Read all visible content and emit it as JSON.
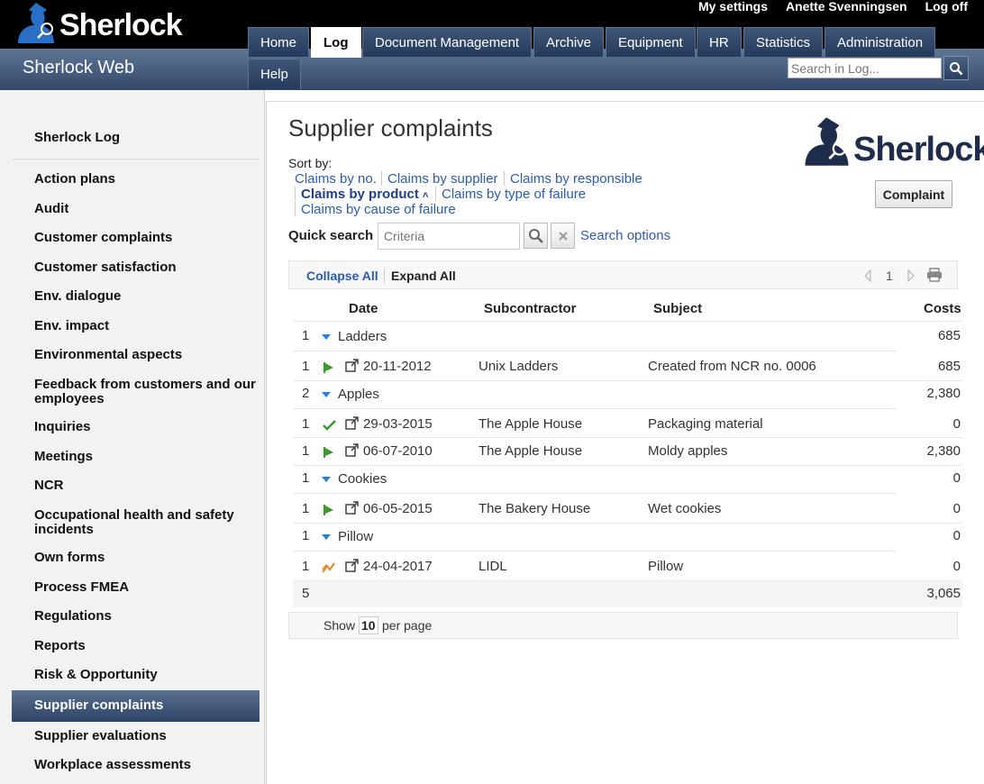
{
  "header": {
    "logo_text": "Sherlock",
    "site_title": "Sherlock Web",
    "top_links": [
      "My settings",
      "Anette Svenningsen",
      "Log off"
    ],
    "tabs": [
      "Home",
      "Log",
      "Document Management",
      "Archive",
      "Equipment",
      "HR",
      "Statistics",
      "Administration",
      "Help"
    ],
    "active_tab": "Log",
    "search_placeholder": "Search in Log..."
  },
  "sidebar": {
    "title": "Sherlock Log",
    "items": [
      "Action plans",
      "Audit",
      "Customer complaints",
      "Customer satisfaction",
      "Env. dialogue",
      "Env. impact",
      "Environmental aspects",
      "Feedback from customers and our employees",
      "Inquiries",
      "Meetings",
      "NCR",
      "Occupational health and safety incidents",
      "Own forms",
      "Process FMEA",
      "Regulations",
      "Reports",
      "Risk & Opportunity",
      "Supplier complaints",
      "Supplier evaluations",
      "Workplace assessments"
    ],
    "active_item": "Supplier complaints"
  },
  "main": {
    "title": "Supplier complaints",
    "logo_text": "Sherlock",
    "complaint_button": "Complaint",
    "sort_label": "Sort by:",
    "sort_options": [
      "Claims by no.",
      "Claims by supplier",
      "Claims by responsible",
      "Claims by product",
      "Claims by type of failure",
      "Claims by cause of failure"
    ],
    "active_sort": "Claims by product",
    "quick_search_label": "Quick search",
    "quick_search_placeholder": "Criteria",
    "search_options": "Search options",
    "collapse_all": "Collapse All",
    "expand_all": "Expand All",
    "page_number": "1",
    "columns": [
      "Date",
      "Subcontractor",
      "Subject",
      "Costs"
    ],
    "groups": [
      {
        "count": "1",
        "name": "Ladders",
        "total": "685",
        "rows": [
          {
            "count": "1",
            "status": "flag-icon",
            "date": "20-11-2012",
            "subcontractor": "Unix Ladders",
            "subject": "Created from NCR no. 0006",
            "costs": "685"
          }
        ]
      },
      {
        "count": "2",
        "name": "Apples",
        "total": "2,380",
        "rows": [
          {
            "count": "1",
            "status": "check-icon",
            "date": "29-03-2015",
            "subcontractor": "The Apple House",
            "subject": "Packaging material",
            "costs": "0"
          },
          {
            "count": "1",
            "status": "flag-icon",
            "date": "06-07-2010",
            "subcontractor": "The Apple House",
            "subject": "Moldy apples",
            "costs": "2,380"
          }
        ]
      },
      {
        "count": "1",
        "name": "Cookies",
        "total": "0",
        "rows": [
          {
            "count": "1",
            "status": "flag-icon",
            "date": "06-05-2015",
            "subcontractor": "The Bakery House",
            "subject": "Wet cookies",
            "costs": "0"
          }
        ]
      },
      {
        "count": "1",
        "name": "Pillow",
        "total": "0",
        "rows": [
          {
            "count": "1",
            "status": "in-progress-icon",
            "date": "24-04-2017",
            "subcontractor": "LIDL",
            "subject": "Pillow",
            "costs": "0"
          }
        ]
      }
    ],
    "total_count": "5",
    "total_costs": "3,065",
    "footer": {
      "show_label": "Show",
      "per_page_value": "10",
      "per_page_label": "per page"
    }
  },
  "colors": {
    "nav_dark": "#2e4366",
    "link_blue": "#2a5cb0",
    "flag_green": "#3a9a2a",
    "progress_orange": "#e0892a"
  }
}
